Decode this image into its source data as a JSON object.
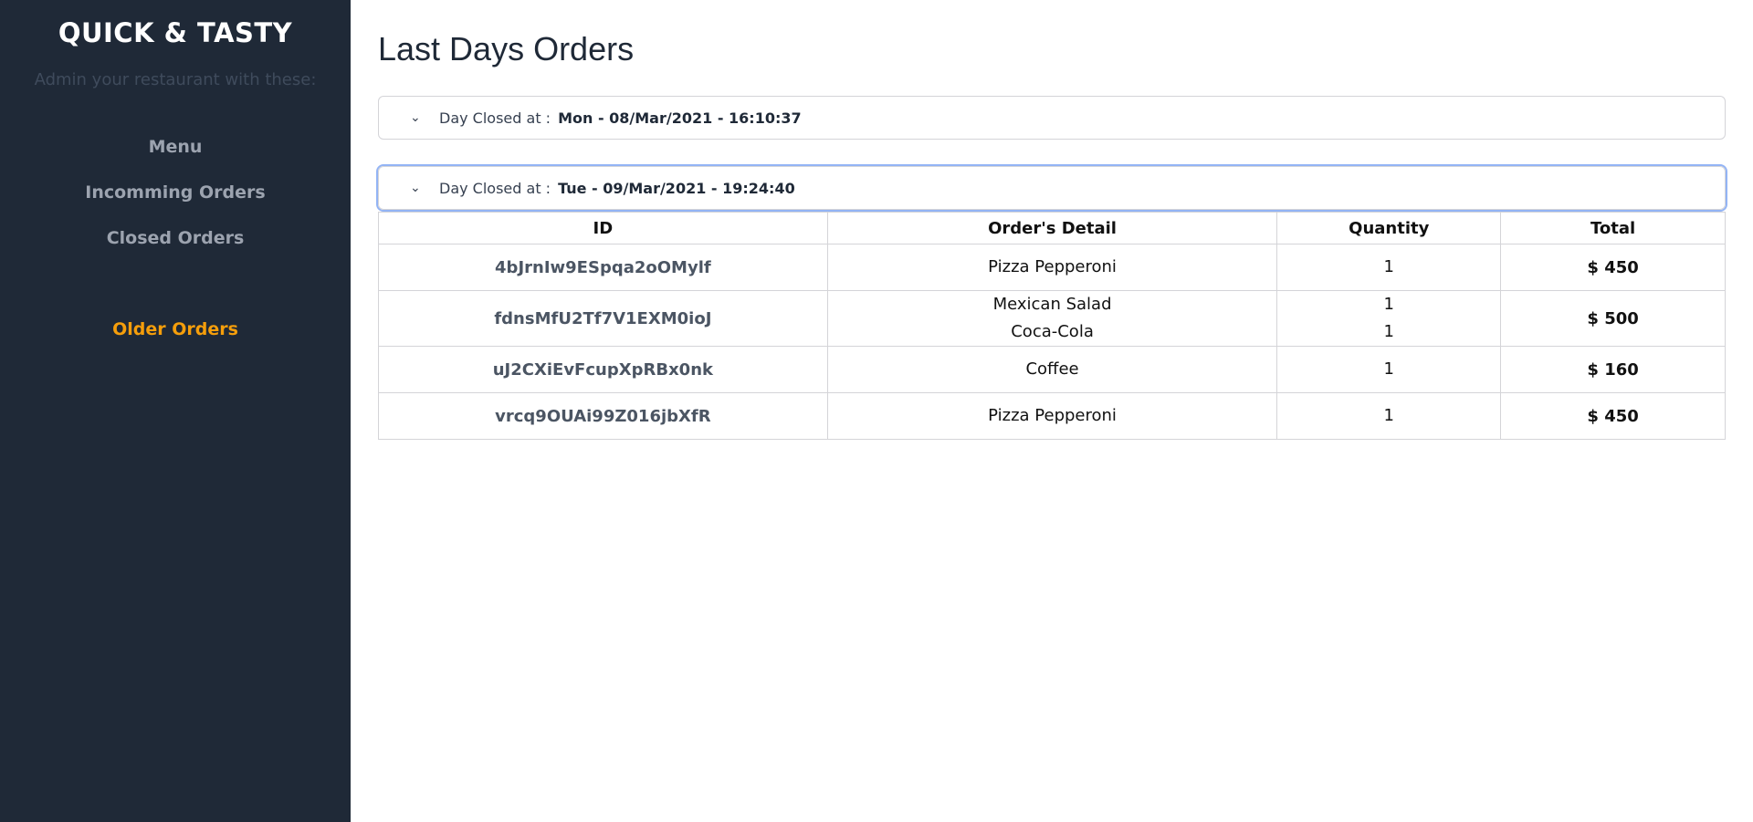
{
  "sidebar": {
    "brand": "QUICK & TASTY",
    "tagline": "Admin your restaurant with these:",
    "items": [
      {
        "label": "Menu"
      },
      {
        "label": "Incomming Orders"
      },
      {
        "label": "Closed Orders"
      },
      {
        "label": "Older Orders",
        "active": true
      }
    ],
    "active_color": "#f59e0b"
  },
  "main": {
    "title": "Last Days Orders",
    "days": [
      {
        "label": "Day Closed at :",
        "date": "Mon - 08/Mar/2021 - 16:10:37",
        "expanded": false
      },
      {
        "label": "Day Closed at :",
        "date": "Tue - 09/Mar/2021 - 19:24:40",
        "expanded": true
      }
    ],
    "table": {
      "headers": [
        "ID",
        "Order's Detail",
        "Quantity",
        "Total"
      ],
      "rows": [
        {
          "id": "4bJrnIw9ESpqa2oOMylf",
          "items": [
            "Pizza Pepperoni"
          ],
          "qty": [
            "1"
          ],
          "total": "$ 450"
        },
        {
          "id": "fdnsMfU2Tf7V1EXM0ioJ",
          "items": [
            "Mexican Salad",
            "Coca-Cola"
          ],
          "qty": [
            "1",
            "1"
          ],
          "total": "$ 500"
        },
        {
          "id": "uJ2CXiEvFcupXpRBx0nk",
          "items": [
            "Coffee"
          ],
          "qty": [
            "1"
          ],
          "total": "$ 160"
        },
        {
          "id": "vrcq9OUAi99Z016jbXfR",
          "items": [
            "Pizza Pepperoni"
          ],
          "qty": [
            "1"
          ],
          "total": "$ 450"
        }
      ]
    }
  }
}
